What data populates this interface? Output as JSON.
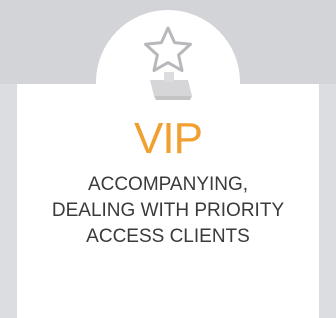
{
  "card": {
    "title": "VIP",
    "title_color": "#f0a030",
    "description_lines": [
      "ACCOMPANYING,",
      "DEALING WITH PRIORITY",
      "ACCESS CLIENTS"
    ]
  },
  "icon": {
    "name": "star-trophy-icon",
    "stroke_color": "#b8b8bc"
  }
}
